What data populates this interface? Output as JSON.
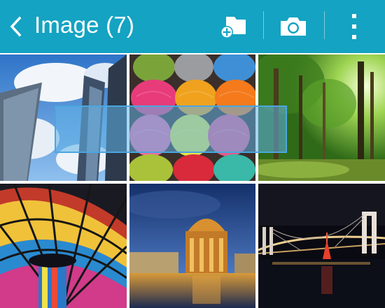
{
  "appbar": {
    "title": "Image (7)",
    "background_color": "#14a3c2",
    "back_icon": "chevron-left-icon",
    "actions": [
      {
        "name": "new-folder",
        "icon": "folder-plus-icon"
      },
      {
        "name": "camera",
        "icon": "camera-icon"
      },
      {
        "name": "more-options",
        "icon": "vertical-dots-icon"
      }
    ]
  },
  "gallery": {
    "items": [
      {
        "subject": "skyscrapers-sky"
      },
      {
        "subject": "yarn-balls"
      },
      {
        "subject": "green-forest"
      },
      {
        "subject": "stained-glass-dome"
      },
      {
        "subject": "palace-of-fine-arts-night"
      },
      {
        "subject": "rainbow-bridge-night"
      }
    ]
  },
  "selection_color": "#4aa6df"
}
